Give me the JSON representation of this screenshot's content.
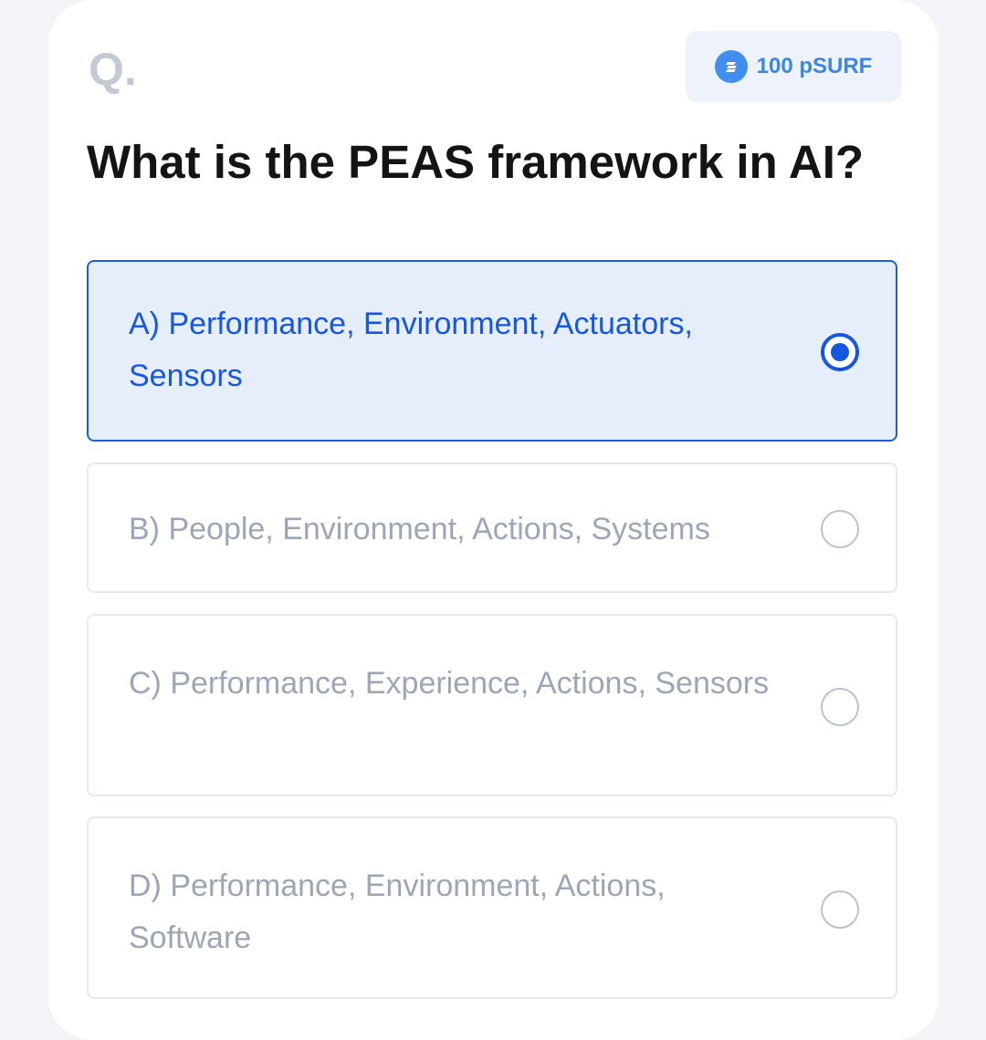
{
  "header": {
    "q_label": "Q.",
    "reward": {
      "icon": "coin-icon",
      "text": "100 pSURF"
    }
  },
  "question": "What is the PEAS framework in AI?",
  "options": [
    {
      "text": "A) Performance, Environment, Actuators, Sensors",
      "selected": true
    },
    {
      "text": "B) People, Environment, Actions, Systems",
      "selected": false
    },
    {
      "text": "C) Performance, Experience, Actions, Sensors",
      "selected": false
    },
    {
      "text": "D) Performance, Environment, Actions, Software",
      "selected": false
    }
  ],
  "colors": {
    "accent": "#1757e0",
    "selected_background": "#e6eefc",
    "unselected_text": "#9ca6b8",
    "badge_text": "#3c86e6"
  }
}
